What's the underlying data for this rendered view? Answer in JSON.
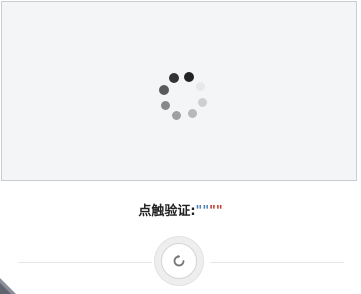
{
  "captcha": {
    "prompt_label": "点触验证:",
    "prompt_quotes": [
      "\"",
      "\"",
      "\"",
      "\""
    ],
    "loading_spinner": {
      "icon": "loading-spinner-icon",
      "dot_colors": [
        "#222222",
        "#e8e8e8",
        "#cfcfcf",
        "#b8b8b8",
        "#a0a0a0",
        "#888888",
        "#5a5a5a",
        "#333333"
      ]
    },
    "refresh_icon": "refresh-icon"
  },
  "colors": {
    "box_background": "#f4f5f7",
    "box_border": "#c9ccd1",
    "quote_blue": "#4a7fb2",
    "quote_red": "#c0392b"
  }
}
